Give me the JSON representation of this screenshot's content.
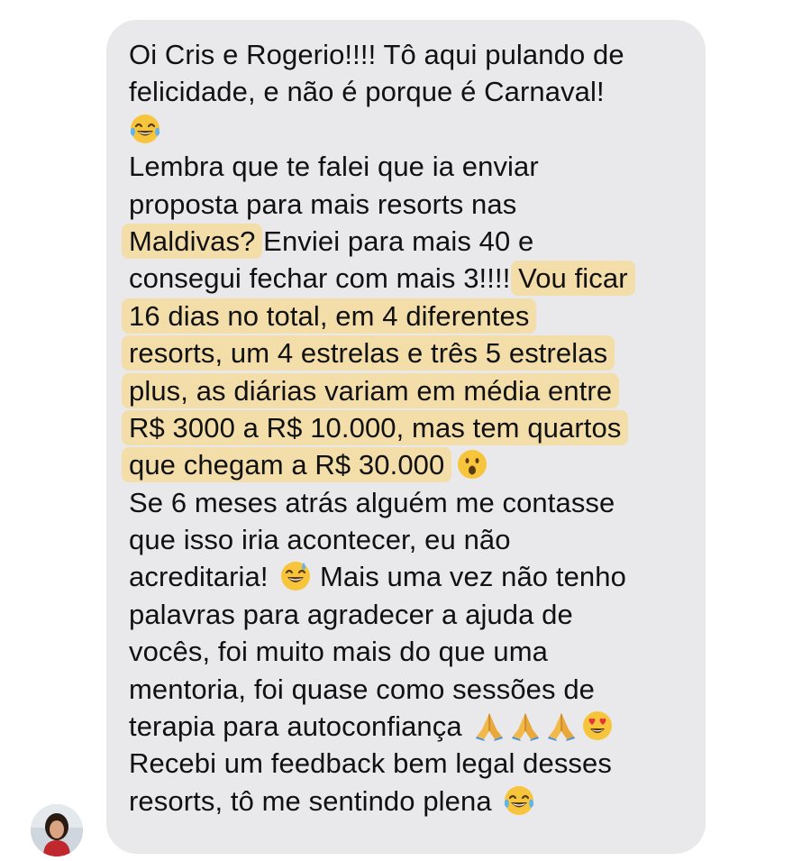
{
  "message": {
    "lines": [
      "Oi Cris e Rogerio!!!! Tô aqui pulando de",
      "felicidade, e não é porque é Carnaval!",
      "",
      "Lembra que te falei que ia enviar",
      "proposta para mais resorts nas",
      "Maldivas?",
      " Enviei para mais 40 e",
      "consegui fechar com mais 3!!!! ",
      "Vou ficar",
      "16 dias no total, em 4 diferentes",
      "resorts, um 4 estrelas e três 5 estrelas",
      "plus, as diárias variam em média entre",
      "R$ 3000 a R$ 10.000, mas tem quartos",
      "que chegam a R$ 30.000",
      "Se 6 meses atrás alguém me contasse",
      "que isso iria acontecer, eu não",
      "acreditaria!",
      " Mais uma vez não tenho",
      "palavras para agradecer a ajuda de",
      "vocês, foi muito mais do que uma",
      "mentoria, foi quase como sessões de",
      "terapia para autoconfiança",
      "Recebi um feedback bem legal desses",
      "resorts, tô me sentindo plena"
    ]
  },
  "icons": {
    "avatar": "user-avatar",
    "laughing": "face-with-tears-of-joy-icon",
    "surprised": "face-with-open-mouth-icon",
    "sweat_smile": "grinning-face-with-sweat-icon",
    "pray": "folded-hands-icon",
    "heart_eyes": "smiling-face-with-heart-eyes-icon"
  },
  "colors": {
    "bubble": "#e9e9eb",
    "highlight": "#fad678",
    "text": "#111111"
  }
}
